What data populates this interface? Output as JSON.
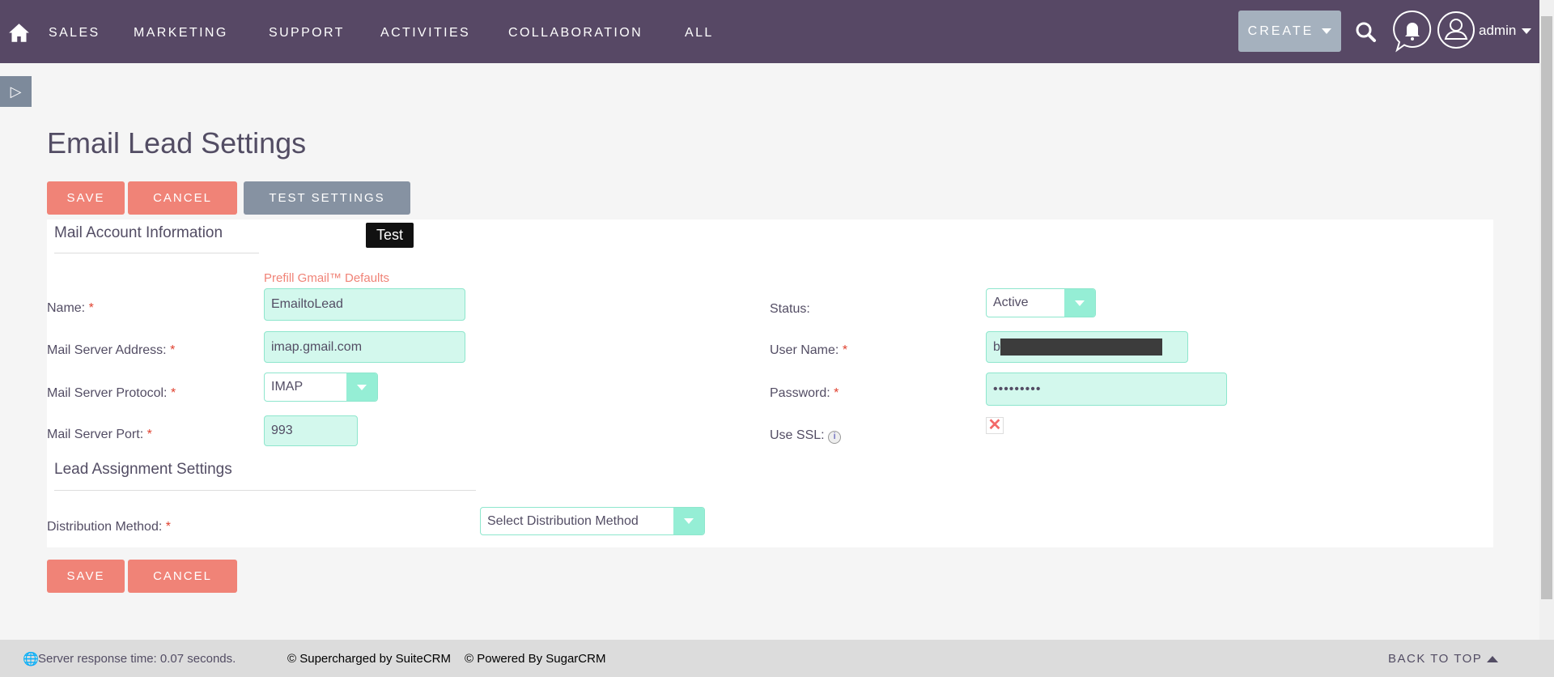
{
  "nav": {
    "items": [
      "SALES",
      "MARKETING",
      "SUPPORT",
      "ACTIVITIES",
      "COLLABORATION",
      "ALL"
    ],
    "create": "CREATE",
    "user": "admin"
  },
  "page": {
    "title": "Email Lead Settings"
  },
  "buttons": {
    "save": "SAVE",
    "cancel": "CANCEL",
    "test": "TEST SETTINGS",
    "tooltip": "Test"
  },
  "mail": {
    "section": "Mail Account Information",
    "prefill": "Prefill Gmail™ Defaults",
    "name_label": "Name:",
    "name_value": "EmailtoLead",
    "server_label": "Mail Server Address:",
    "server_value": "imap.gmail.com",
    "protocol_label": "Mail Server Protocol:",
    "protocol_value": "IMAP",
    "port_label": "Mail Server Port:",
    "port_value": "993",
    "status_label": "Status:",
    "status_value": "Active",
    "user_label": "User Name:",
    "user_value": "b",
    "password_label": "Password:",
    "password_value": "•••••••••",
    "ssl_label": "Use SSL:"
  },
  "lead": {
    "section": "Lead Assignment Settings",
    "dist_label": "Distribution Method:",
    "dist_value": "Select Distribution Method"
  },
  "footer": {
    "response": "Server response time: 0.07 seconds.",
    "suite": "© Supercharged by SuiteCRM",
    "sugar": "© Powered By SugarCRM",
    "top": "BACK TO TOP"
  },
  "colors": {
    "header": "#574865",
    "button": "#f08377",
    "input": "#d3f8ed"
  }
}
